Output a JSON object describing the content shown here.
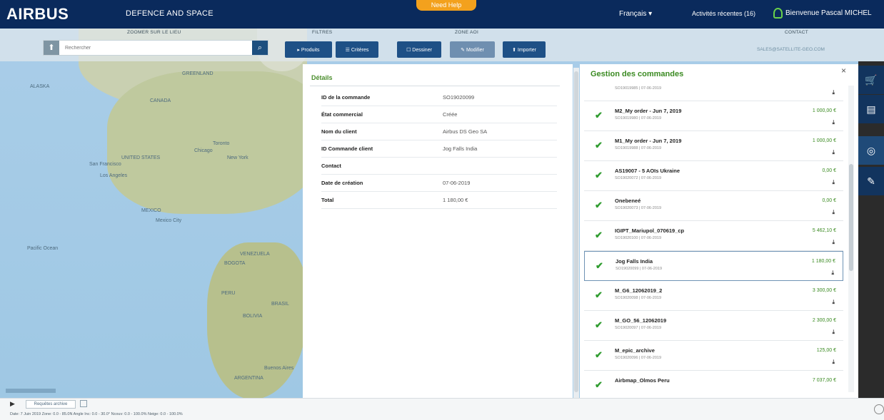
{
  "topbar": {
    "logo": "AIRBUS",
    "division": "DEFENCE AND SPACE",
    "help_label": "Need Help",
    "language": "Français ▾",
    "recent_activity": "Activités récentes (16)",
    "user_greeting": "Bienvenue Pascal MICHEL"
  },
  "toolbar": {
    "zoom_group_label": "ZOOMER SUR LE LIEU",
    "filters_group_label": "FILTRES",
    "aoi_group_label": "ZONE AOI",
    "contact_group_label": "CONTACT",
    "search_placeholder": "Rechercher",
    "buttons": {
      "products": "▸ Produits",
      "criteria": "☰ Critères",
      "draw": "☐ Dessiner",
      "edit": "✎ Modifier",
      "import": "⬆ Importer"
    },
    "contact_email": "SALES@SATELLITE-GEO.COM"
  },
  "map": {
    "labels": [
      "ALASKA",
      "CANADA",
      "UNITED STATES",
      "San Francisco",
      "Los Angeles",
      "Chicago",
      "New York",
      "Toronto",
      "Mexico City",
      "MEXICO",
      "Pacific Ocean",
      "VENEZUELA",
      "BOGOTA",
      "PERU",
      "BRASIL",
      "BOLIVIA",
      "Buenos Aires",
      "ARGENTINA",
      "GREENLAND"
    ]
  },
  "details": {
    "title": "Détails",
    "rows": [
      {
        "label": "ID de la commande",
        "value": "SO19020099"
      },
      {
        "label": "État commercial",
        "value": "Créée"
      },
      {
        "label": "Nom du client",
        "value": "Airbus DS Geo SA"
      },
      {
        "label": "ID Commande client",
        "value": "Jog Falls India"
      },
      {
        "label": "Contact",
        "value": ""
      },
      {
        "label": "Date de création",
        "value": "07-06-2019"
      },
      {
        "label": "Total",
        "value": "1 180,00 €"
      }
    ]
  },
  "orders": {
    "title": "Gestion des commandes",
    "close_label": "×",
    "items": [
      {
        "name": "",
        "sub": "SO19019985 | 07-06-2019",
        "amount": ""
      },
      {
        "name": "M2_My order - Jun 7, 2019",
        "sub": "SO19019980 | 07-06-2019",
        "amount": "1 000,00 €"
      },
      {
        "name": "M1_My order - Jun 7, 2019",
        "sub": "SO19019988 | 07-06-2019",
        "amount": "1 000,00 €"
      },
      {
        "name": "AS19007 - 5 AOIs Ukraine",
        "sub": "SO19020072 | 07-06-2019",
        "amount": "0,00 €"
      },
      {
        "name": "Onebeneé",
        "sub": "SO19020073 | 07-06-2019",
        "amount": "0,00 €"
      },
      {
        "name": "IGIPT_Mariupol_070619_cp",
        "sub": "SO19020100 | 07-06-2019",
        "amount": "5 462,10 €"
      },
      {
        "name": "Jog Falls India",
        "sub": "SO19020099 | 07-06-2019",
        "amount": "1 180,00 €"
      },
      {
        "name": "M_G6_12062019_2",
        "sub": "SO19020098 | 07-06-2019",
        "amount": "3 300,00 €"
      },
      {
        "name": "M_GO_56_12062019",
        "sub": "SO19020097 | 07-06-2019",
        "amount": "2 300,00 €"
      },
      {
        "name": "M_epic_archive",
        "sub": "SO19020096 | 07-06-2019",
        "amount": "125,00 €"
      },
      {
        "name": "Airbmap_Olmos Peru",
        "sub": "",
        "amount": "7 037,00 €"
      }
    ]
  },
  "bottom": {
    "archive_label": "Requêtes archive",
    "coordinates": "Date: 7 Juin 2019   Zone: 0.0 - 85.0N   Angle Inc: 0.0 - 30.0°   Ncouv: 0.0 - 100.0%   Neige: 0.0 - 100.0%"
  }
}
